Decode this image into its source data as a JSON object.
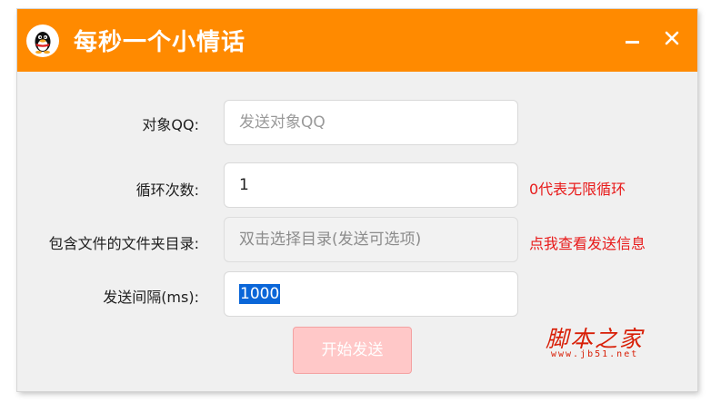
{
  "window": {
    "title": "每秒一个小情话",
    "colors": {
      "titlebar": "#ff8a00",
      "hint": "#e81a1a",
      "start_button": "#ffc8c8"
    }
  },
  "controls": {
    "minimize_icon": "minimize-icon",
    "close_icon": "close-icon"
  },
  "form": {
    "target": {
      "label": "对象QQ:",
      "placeholder": "发送对象QQ",
      "value": ""
    },
    "loop": {
      "label": "循环次数:",
      "value": "1",
      "hint": "0代表无限循环"
    },
    "folder": {
      "label": "包含文件的文件夹目录:",
      "placeholder": "双击选择目录(发送可选项)",
      "hint": "点我查看发送信息"
    },
    "interval": {
      "label": "发送间隔(ms):",
      "value": "1000"
    },
    "start_label": "开始发送"
  },
  "watermark": {
    "main": "脚本之家",
    "sub": "www.jb51.net"
  }
}
